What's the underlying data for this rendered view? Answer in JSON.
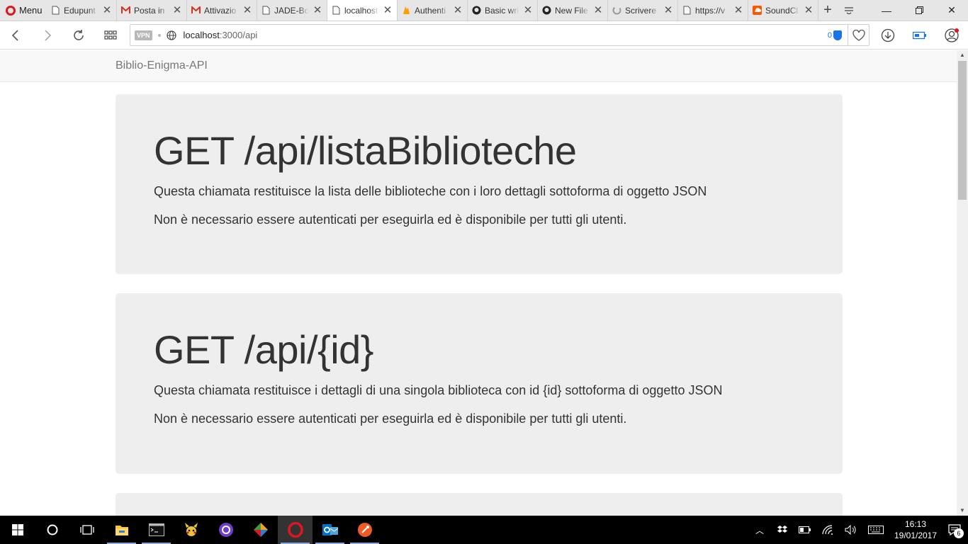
{
  "browser": {
    "menu_label": "Menu",
    "tabs": [
      {
        "label": "Edupunt",
        "icon": "document-icon"
      },
      {
        "label": "Posta in",
        "icon": "gmail-icon"
      },
      {
        "label": "Attivazio",
        "icon": "gmail-icon"
      },
      {
        "label": "JADE-Bo",
        "icon": "document-icon"
      },
      {
        "label": "localhost",
        "icon": "document-icon",
        "active": true
      },
      {
        "label": "Authenti",
        "icon": "firebase-icon"
      },
      {
        "label": "Basic wri",
        "icon": "github-icon"
      },
      {
        "label": "New File",
        "icon": "github-icon"
      },
      {
        "label": "Scrivere",
        "icon": "loading-icon"
      },
      {
        "label": "https://v",
        "icon": "document-icon"
      },
      {
        "label": "SoundCl",
        "icon": "soundcloud-icon"
      }
    ],
    "address": {
      "vpn_label": "VPN",
      "url_host": "localhost",
      "url_path": ":3000/api",
      "adblock_count": "0"
    }
  },
  "page": {
    "brand": "Biblio-Enigma-API",
    "endpoints": [
      {
        "title": "GET /api/listaBiblioteche",
        "description": "Questa chiamata restituisce la lista delle biblioteche con i loro dettagli sottoforma di oggetto JSON",
        "note": "Non è necessario essere autenticati per eseguirla ed è disponibile per tutti gli utenti."
      },
      {
        "title": "GET /api/{id}",
        "description": "Questa chiamata restituisce i dettagli di una singola biblioteca con id {id} sottoforma di oggetto JSON",
        "note": "Non è necessario essere autenticati per eseguirla ed è disponibile per tutti gli utenti."
      }
    ]
  },
  "taskbar": {
    "apps": [
      "windows-start-icon",
      "cortana-icon",
      "task-view-icon",
      "file-explorer-icon",
      "terminal-icon",
      "pokemon-icon",
      "github-desktop-icon",
      "gitkraken-icon",
      "opera-icon",
      "outlook-icon",
      "postman-icon"
    ],
    "time": "16:13",
    "date": "19/01/2017",
    "notification_count": "6"
  },
  "colors": {
    "jumbotron_bg": "#eeeeee",
    "navbar_bg": "#f8f8f8",
    "opera_red": "#e0161f",
    "accent_blue": "#1a73e8"
  }
}
